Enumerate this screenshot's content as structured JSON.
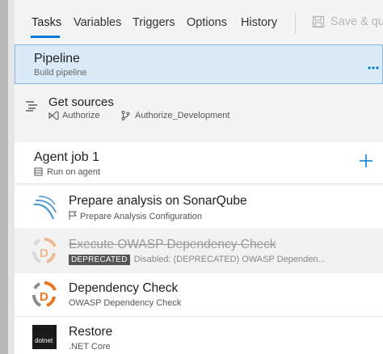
{
  "tabs": {
    "items": [
      {
        "label": "Tasks",
        "active": true
      },
      {
        "label": "Variables"
      },
      {
        "label": "Triggers"
      },
      {
        "label": "Options"
      },
      {
        "label": "History"
      }
    ],
    "save_label": "Save & que"
  },
  "pipeline": {
    "title": "Pipeline",
    "subtitle": "Build pipeline",
    "more_icon": "ellipsis-icon"
  },
  "sources": {
    "title": "Get sources",
    "repo": "Authorize",
    "branch": "Authorize_Development"
  },
  "agent_job": {
    "title": "Agent job 1",
    "subtitle": "Run on agent"
  },
  "tasks": [
    {
      "title": "Prepare analysis on SonarQube",
      "subtitle": "Prepare Analysis Configuration",
      "icon": "sonarqube-icon",
      "disabled": false
    },
    {
      "title": "Execute OWASP Dependency Check",
      "badge": "DEPRECATED",
      "subtitle": "Disabled: (DEPRECATED) OWASP Dependen...",
      "icon": "owasp-icon",
      "disabled": true
    },
    {
      "title": "Dependency Check",
      "subtitle": "OWASP Dependency Check",
      "icon": "owasp-icon",
      "disabled": false
    },
    {
      "title": "Restore",
      "subtitle": ".NET Core",
      "icon": "dotnet-icon",
      "icon_text": "dotnet",
      "disabled": false
    }
  ],
  "colors": {
    "accent": "#0078d4",
    "selected_bg": "#dbeaf7",
    "owasp_orange": "#e87722"
  }
}
